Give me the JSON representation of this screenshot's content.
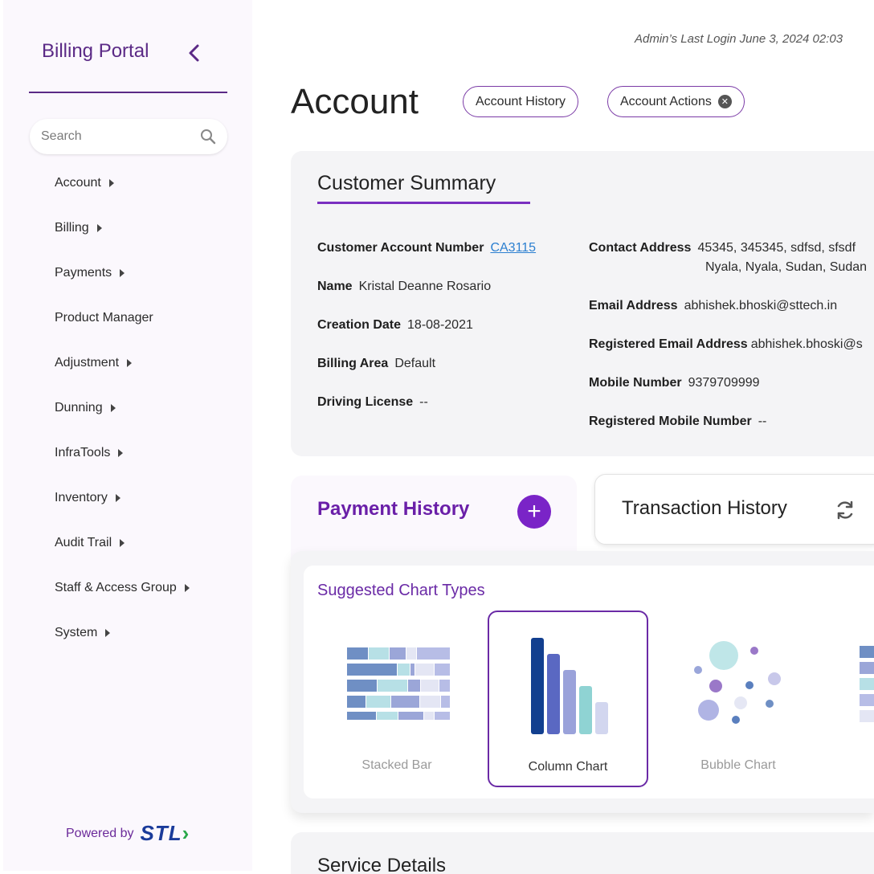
{
  "sidebar": {
    "brand": "Billing Portal",
    "search_placeholder": "Search",
    "items": [
      {
        "label": "Account",
        "has_submenu": true
      },
      {
        "label": "Billing",
        "has_submenu": true
      },
      {
        "label": "Payments",
        "has_submenu": true
      },
      {
        "label": "Product Manager",
        "has_submenu": false
      },
      {
        "label": "Adjustment",
        "has_submenu": true
      },
      {
        "label": "Dunning",
        "has_submenu": true
      },
      {
        "label": "InfraTools",
        "has_submenu": true
      },
      {
        "label": "Inventory",
        "has_submenu": true
      },
      {
        "label": "Audit Trail",
        "has_submenu": true
      },
      {
        "label": "Staff & Access Group",
        "has_submenu": true
      },
      {
        "label": "System",
        "has_submenu": true
      }
    ],
    "powered_by": "Powered by",
    "logo_text": "STL"
  },
  "header": {
    "last_login": "Admin’s Last Login June 3, 2024 02:03",
    "title": "Account",
    "chips": [
      "Account History",
      "Account Actions"
    ]
  },
  "summary": {
    "title": "Customer Summary",
    "left": [
      {
        "label": "Customer Account Number",
        "value": "CA3115"
      },
      {
        "label": "Name",
        "value": "Kristal Deanne Rosario"
      },
      {
        "label": "Creation Date",
        "value": "18-08-2021"
      },
      {
        "label": "Billing Area",
        "value": "Default"
      },
      {
        "label": "Driving License",
        "value": "--"
      }
    ],
    "right": [
      {
        "label": "Contact Address",
        "value": "45345, 345345, sdfsd, sfsdf",
        "value_line2": "Nyala, Nyala, Sudan, Sudan"
      },
      {
        "label": "Email Address",
        "value": "abhishek.bhoski@sttech.in"
      },
      {
        "label": "Registered Email Address",
        "value": "abhishek.bhoski@s"
      },
      {
        "label": "Mobile Number",
        "value": "9379709999"
      },
      {
        "label": "Registered Mobile Number",
        "value": "--"
      }
    ]
  },
  "payment_history": {
    "title": "Payment History"
  },
  "transaction_history": {
    "title": "Transaction History"
  },
  "chart_types": {
    "heading": "Suggested Chart Types",
    "options": [
      {
        "label": "Stacked Bar",
        "selected": false
      },
      {
        "label": "Column Chart",
        "selected": true
      },
      {
        "label": "Bubble Chart",
        "selected": false
      }
    ]
  },
  "service_details": {
    "title": "Service Details"
  },
  "colors": {
    "accent": "#6a1fa8",
    "brand": "#5b2a86",
    "link": "#2b7fd0"
  }
}
